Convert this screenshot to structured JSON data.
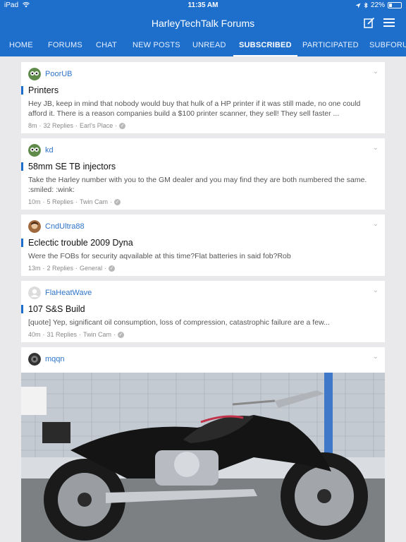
{
  "status": {
    "device": "iPad",
    "time": "11:35 AM",
    "battery": "22%",
    "battery_level": 0.22
  },
  "app": {
    "title": "HarleyTechTalk Forums"
  },
  "tabs": [
    {
      "label": "HOME"
    },
    {
      "label": "FORUMS"
    },
    {
      "label": "CHAT"
    },
    {
      "label": "NEW POSTS"
    },
    {
      "label": "UNREAD"
    },
    {
      "label": "SUBSCRIBED",
      "active": true
    },
    {
      "label": "PARTICIPATED"
    },
    {
      "label": "SUBFORU"
    }
  ],
  "threads": [
    {
      "author": "PoorUB",
      "title": "Printers",
      "excerpt": "Hey JB, keep in mind that nobody would buy that hulk of a HP printer if it was still made, no one could afford it. There is a reason companies build a $100 printer scanner, they sell! They sell faster ...",
      "time": "8m",
      "replies": "32 Replies",
      "forum": "Earl's Place"
    },
    {
      "author": "kd",
      "title": "58mm SE TB injectors",
      "excerpt": "Take the Harley number with you to the GM dealer and you may find they are both numbered the same. :smiled: :wink:",
      "time": "10m",
      "replies": "5 Replies",
      "forum": "Twin Cam"
    },
    {
      "author": "CndUltra88",
      "title": "Eclectic trouble 2009 Dyna",
      "excerpt": "Were the FOBs for security aqvailable at this time?Flat batteries in said fob?Rob",
      "time": "13m",
      "replies": "2 Replies",
      "forum": "General"
    },
    {
      "author": "FlaHeatWave",
      "title": "107 S&S Build",
      "excerpt": "[quote] Yep, significant oil consumption, loss of compression, catastrophic failure are a few...",
      "time": "40m",
      "replies": "31 Replies",
      "forum": "Twin Cam"
    }
  ],
  "photo_post": {
    "author": "mqqn"
  },
  "colors": {
    "brand": "#1e6fcc",
    "link": "#2f74c9"
  }
}
